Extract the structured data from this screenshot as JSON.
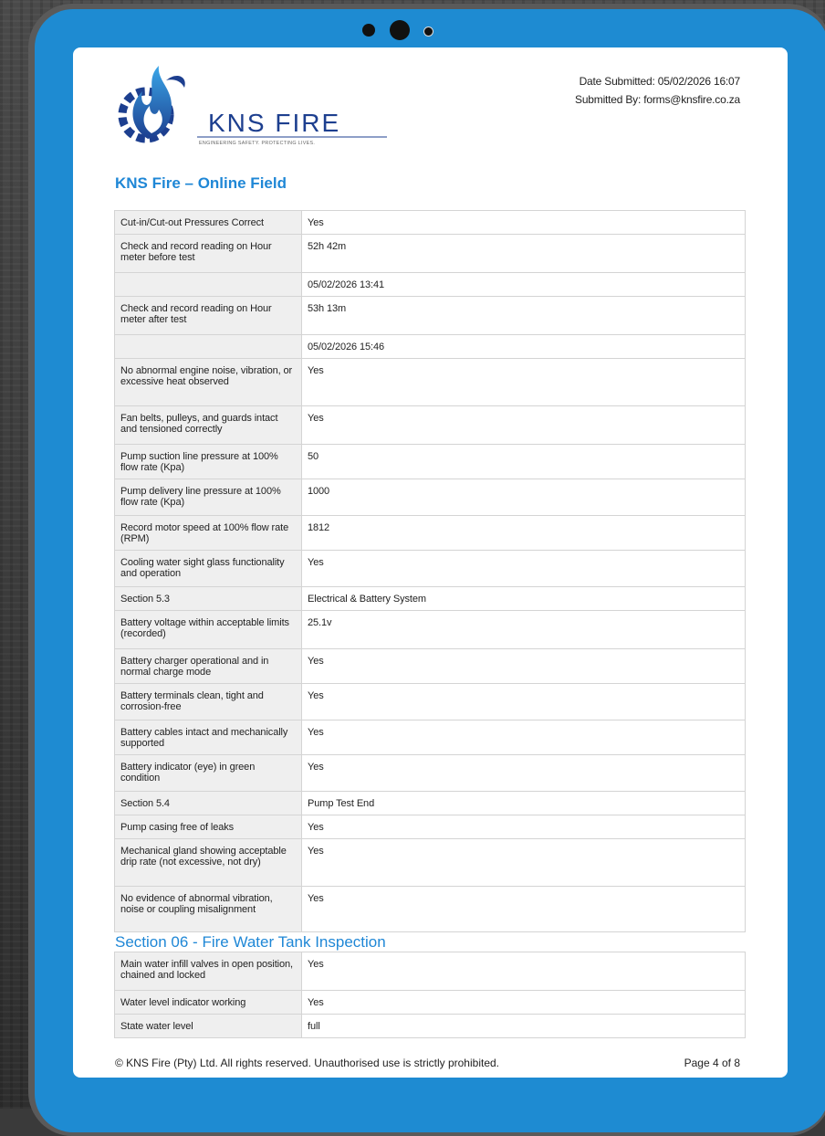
{
  "header": {
    "brand_name": "KNS FIRE",
    "tagline": "ENGINEERING SAFETY. PROTECTING LIVES.",
    "date_submitted": "Date Submitted: 05/02/2026 16:07",
    "submitted_by": "Submitted By: forms@knsfire.co.za"
  },
  "doc_title": "KNS Fire – Online Field",
  "main_rows": [
    {
      "q": "Cut-in/Cut-out Pressures Correct",
      "a": "Yes"
    },
    {
      "q": "Check and record reading on Hour meter before test",
      "a": "52h 42m"
    },
    {
      "q": "",
      "a": "05/02/2026 13:41"
    },
    {
      "q": "Check and record reading on Hour meter after test",
      "a": "53h 13m"
    },
    {
      "q": "",
      "a": "05/02/2026 15:46"
    },
    {
      "q": "No abnormal engine noise, vibration, or excessive heat observed",
      "a": "Yes"
    },
    {
      "q": "Fan belts, pulleys, and guards intact and tensioned correctly",
      "a": "Yes"
    },
    {
      "q": "Pump suction line pressure at 100% flow rate (Kpa)",
      "a": "50"
    },
    {
      "q": "Pump delivery line pressure at 100% flow rate (Kpa)",
      "a": "1000"
    },
    {
      "q": "Record motor speed at 100% flow rate (RPM)",
      "a": "1812"
    },
    {
      "q": "Cooling water sight glass functionality and operation",
      "a": "Yes"
    },
    {
      "q": "Section 5.3",
      "a": "Electrical & Battery System"
    },
    {
      "q": "Battery voltage within acceptable limits (recorded)",
      "a": "25.1v"
    },
    {
      "q": "Battery charger operational and in normal charge mode",
      "a": "Yes"
    },
    {
      "q": "Battery terminals clean, tight and corrosion-free",
      "a": "Yes"
    },
    {
      "q": "Battery cables intact and mechanically supported",
      "a": "Yes"
    },
    {
      "q": "Battery indicator (eye) in green condition",
      "a": "Yes"
    },
    {
      "q": "Section 5.4",
      "a": "Pump Test End"
    },
    {
      "q": "Pump casing free of leaks",
      "a": "Yes"
    },
    {
      "q": "Mechanical gland showing acceptable drip rate (not excessive, not dry)",
      "a": "Yes"
    },
    {
      "q": "No evidence of abnormal vibration, noise or coupling misalignment",
      "a": "Yes"
    }
  ],
  "section_06": {
    "heading": "Section 06 - Fire Water Tank Inspection",
    "rows": [
      {
        "q": "Main water infill valves in open position, chained and locked",
        "a": "Yes"
      },
      {
        "q": "Water level indicator working",
        "a": "Yes"
      },
      {
        "q": "State water level",
        "a": "full"
      }
    ]
  },
  "footer": {
    "copyright": "© KNS Fire (Pty) Ltd. All rights reserved. Unauthorised use is strictly prohibited.",
    "page": "Page 4 of 8"
  },
  "colors": {
    "tablet_body": "#1e8bd2",
    "heading_blue": "#1f87d6",
    "logo_navy": "#1d3f8f",
    "label_cell": "#efefef"
  }
}
